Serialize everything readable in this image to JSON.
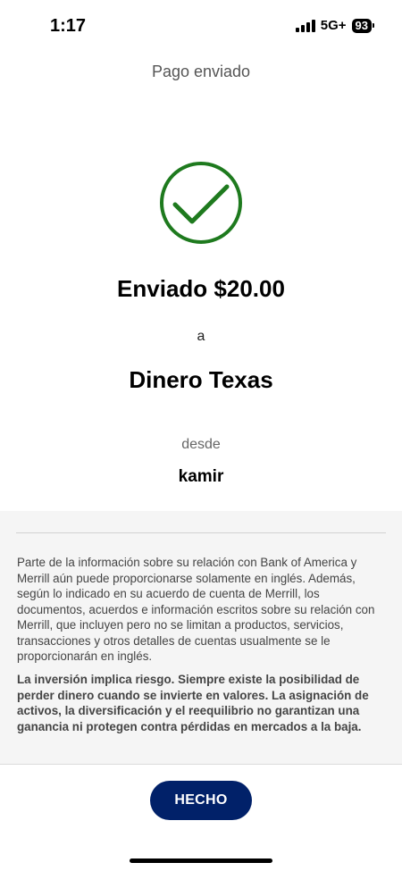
{
  "status_bar": {
    "time": "1:17",
    "network": "5G+",
    "battery": "93"
  },
  "header": {
    "title": "Pago enviado"
  },
  "confirmation": {
    "icon": "checkmark-circle-icon",
    "amount_text": "Enviado $20.00",
    "to_label": "a",
    "recipient": "Dinero Texas",
    "from_label": "desde",
    "sender": "kamir",
    "success_color": "#1e7a1e"
  },
  "disclosure": {
    "info_text": "Parte de la información sobre su relación con Bank of America y Merrill aún puede proporcionarse solamente en inglés. Además, según lo indicado en su acuerdo de cuenta de Merrill, los documentos, acuerdos e información escritos sobre su relación con Merrill, que incluyen pero no se limitan a productos, servicios, transacciones y otros detalles de cuentas usualmente se le proporcionarán en inglés.",
    "risk_text": "La inversión implica riesgo. Siempre existe la posibilidad de perder dinero cuando se invierte en valores. La asignación de activos, la diversificación y el reequilibrio no garantizan una ganancia ni protegen contra pérdidas en mercados a la baja."
  },
  "footer": {
    "done_label": "HECHO",
    "button_color": "#012169"
  }
}
